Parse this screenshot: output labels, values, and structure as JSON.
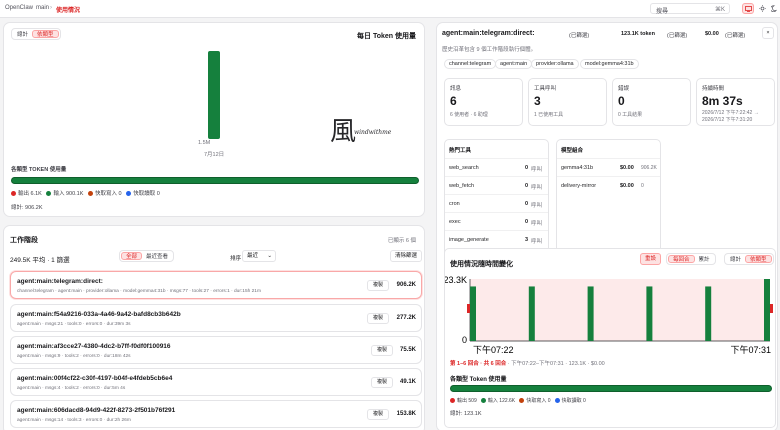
{
  "topbar": {
    "app": "OpenClaw",
    "crumb_mid": "main",
    "crumb_active": "使用情況",
    "search_label": "搜尋",
    "search_shortcut": "⌘K"
  },
  "left": {
    "toggle_total": "總計",
    "toggle_type": "依類型",
    "daily_title": "每日 Token 使用量",
    "bar_label": "1.5M",
    "bar_date": "7月12日",
    "bar_value": 1500000,
    "by_type_title": "各類型 TOKEN 使用量",
    "legend": [
      {
        "label": "輸出 6.1K",
        "color": "#dc2626"
      },
      {
        "label": "輸入 900.1K",
        "color": "#15803d"
      },
      {
        "label": "快取寫入 0",
        "color": "#c2410c"
      },
      {
        "label": "快取讀取 0",
        "color": "#2563eb"
      }
    ],
    "total": "總計: 906.2K",
    "watermark": "windwithme"
  },
  "sessions": {
    "title": "工作階段",
    "shown": "已顯示 6 個",
    "avg": "249.5K 平均 · 1 篩選",
    "tab_all": "全部",
    "tab_recent": "最近查看",
    "sort_label": "排序",
    "sort_value": "最近",
    "clear": "清除篩選",
    "copy": "複製",
    "rows": [
      {
        "name": "agent:main:telegram:direct:",
        "meta": "channel:telegram · agent:main · provider:ollama · model:gemma4:31b · msgs:77 · tools:27 · errors:1 · dur:15h 21m",
        "tokens": "906.2K"
      },
      {
        "name": "agent:main:f54a9216-033a-4a46-9a42-bafd8cb3b642b",
        "meta": "agent:main · msgs:21 · tools:0 · errors:0 · dur:39m 3s",
        "tokens": "277.2K"
      },
      {
        "name": "agent:main:af3cce27-4380-4dc2-b7ff-f0df0f100916",
        "meta": "agent:main · msgs:9 · tools:2 · errors:0 · dur:18m 42s",
        "tokens": "75.5K"
      },
      {
        "name": "agent:main:00f4cf22-c30f-4197-b04f-e4fdeb5cb6e4",
        "meta": "agent:main · msgs:4 · tools:2 · errors:0 · dur:5m 4s",
        "tokens": "49.1K"
      },
      {
        "name": "agent:main:606dacd8-94d9-422f-8273-2f501b76f291",
        "meta": "agent:main · msgs:14 · tools:3 · errors:0 · dur:2h 26m",
        "tokens": "153.8K"
      }
    ]
  },
  "detail": {
    "title": "agent:main:telegram:direct:",
    "badge": "(已篩選)",
    "tokens": "123.1K token",
    "tokens_badge": "(已篩選)",
    "cost": "$0.00",
    "cost_badge": "(已篩選)",
    "desc": "歷史沿革包含 9 個工作階段執行個體。",
    "pills": [
      "channel:telegram",
      "agent:main",
      "provider:ollama",
      "model:gemma4:31b"
    ],
    "stats": [
      {
        "label": "訊息",
        "value": "6",
        "sub": "6 使用者 · 6 助理"
      },
      {
        "label": "工具呼叫",
        "value": "3",
        "sub": "1 已使用工具"
      },
      {
        "label": "錯誤",
        "value": "0",
        "sub": "0 工具結果"
      },
      {
        "label": "持續時間",
        "value": "8m 37s",
        "sub": "2026/7/12 下午7:22:42 →",
        "sub2": "2026/7/12 下午7:31:20"
      }
    ],
    "hot_tools_title": "熱門工具",
    "hot_tools": [
      {
        "name": "web_search",
        "count": "0",
        "unit": "呼叫"
      },
      {
        "name": "web_fetch",
        "count": "0",
        "unit": "呼叫"
      },
      {
        "name": "cron",
        "count": "0",
        "unit": "呼叫"
      },
      {
        "name": "exec",
        "count": "0",
        "unit": "呼叫"
      },
      {
        "name": "image_generate",
        "count": "3",
        "unit": "呼叫"
      }
    ],
    "models_title": "模型組合",
    "models": [
      {
        "name": "gemma4:31b",
        "cost": "$0.00",
        "tokens": "906.2K"
      },
      {
        "name": "delivery-mirror",
        "cost": "$0.00",
        "tokens": "0"
      }
    ]
  },
  "timeline": {
    "title": "使用情況隨時間變化",
    "reset": "重設",
    "per_turn": "每回合",
    "cumulative": "累計",
    "total": "總計",
    "by_type": "依類型",
    "ytop": "23.3K",
    "ybottom": "0",
    "xstart": "下午07:22",
    "xend": "下午07:31",
    "range_prefix": "第 1–6 回合 · 共 6 回合",
    "range_rest": " · 下午07:22–下午07:31 · 123.1K · $0.00",
    "by_type_title": "各類型 Token 使用量",
    "legend": [
      {
        "label": "輸出 509",
        "color": "#dc2626"
      },
      {
        "label": "輸入 122.6K",
        "color": "#15803d"
      },
      {
        "label": "快取寫入 0",
        "color": "#c2410c"
      },
      {
        "label": "快取讀取 0",
        "color": "#2563eb"
      }
    ],
    "total_line": "總計: 123.1K"
  },
  "chart_data": [
    {
      "type": "bar",
      "title": "每日 Token 使用量",
      "categories": [
        "7月12日"
      ],
      "values": [
        1500000
      ],
      "data_labels": [
        "1.5M"
      ]
    },
    {
      "type": "bar",
      "title": "使用情況隨時間變化",
      "categories": [
        "1",
        "2",
        "3",
        "4",
        "5",
        "6"
      ],
      "values": [
        20500,
        20500,
        20500,
        20500,
        20500,
        23300
      ],
      "ylim": [
        0,
        23300
      ],
      "xlabel": "",
      "ylabel": ""
    }
  ]
}
